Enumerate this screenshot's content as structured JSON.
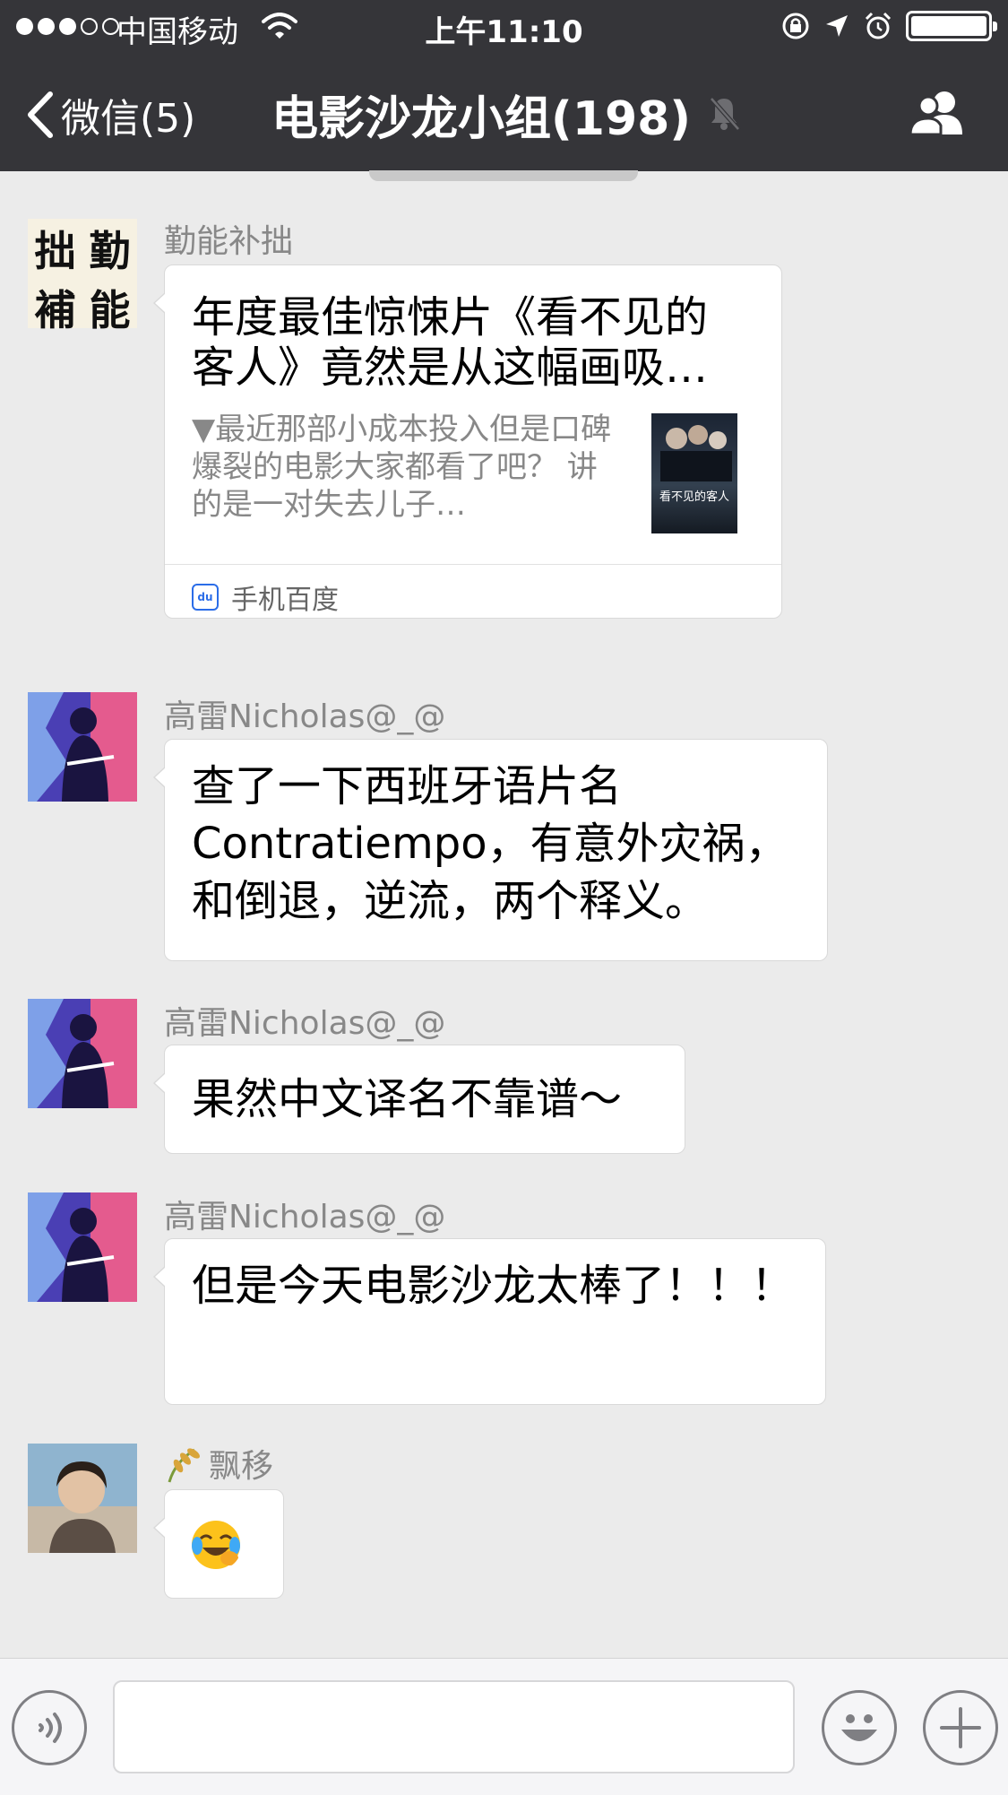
{
  "status_bar": {
    "carrier": "中国移动",
    "time": "上午11:10",
    "signal_bars": 3,
    "signal_total": 5,
    "battery_level": 1.0
  },
  "nav": {
    "back_label": "微信(5)",
    "title": "电影沙龙小组(198)"
  },
  "messages": [
    {
      "sender": "勤能补拙",
      "avatar_text": [
        "勤",
        "補",
        "能",
        "拙"
      ],
      "link": {
        "title": "年度最佳惊悚片《看不见的客人》竟然是从这幅画吸…",
        "description": "▼最近那部小成本投入但是口碑爆裂的电影大家都看了吧？  讲的是一对失去儿子…",
        "thumb_caption": "看不见的客人",
        "source": "手机百度"
      }
    },
    {
      "sender": "高雷Nicholas@_@",
      "text": "查了一下西班牙语片名Contratiempo，有意外灾祸，和倒退，逆流，两个释义。"
    },
    {
      "sender": "高雷Nicholas@_@",
      "text": "果然中文译名不靠谱～"
    },
    {
      "sender": "高雷Nicholas@_@",
      "text": "但是今天电影沙龙太棒了！！！"
    },
    {
      "sender": "飘移",
      "emoji": "crying-laughing-emoji"
    }
  ],
  "colors": {
    "nav_bg": "#353539",
    "chat_bg": "#ebebeb",
    "bubble_bg": "#ffffff",
    "sender": "#888888"
  }
}
